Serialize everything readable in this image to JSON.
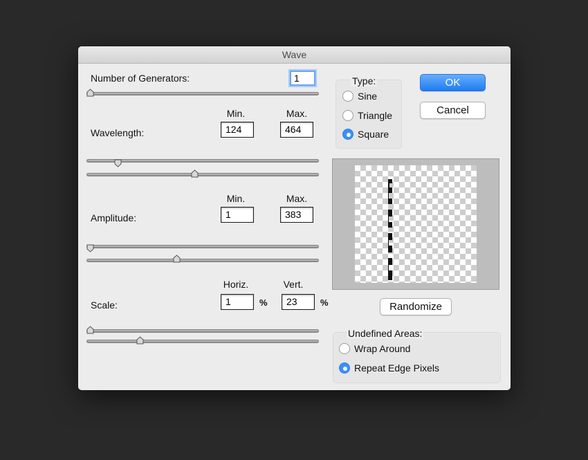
{
  "window": {
    "title": "Wave"
  },
  "generators": {
    "label": "Number of Generators:",
    "value": "1",
    "slider_position": 0.0
  },
  "column_headers": {
    "min": "Min.",
    "max": "Max.",
    "horiz": "Horiz.",
    "vert": "Vert."
  },
  "wavelength": {
    "label": "Wavelength:",
    "min": "124",
    "max": "464",
    "min_slider": 0.13,
    "max_slider": 0.46
  },
  "amplitude": {
    "label": "Amplitude:",
    "min": "1",
    "max": "383",
    "min_slider": 0.0,
    "max_slider": 0.39
  },
  "scale": {
    "label": "Scale:",
    "horiz": "1",
    "vert": "23",
    "unit": "%",
    "horiz_slider": 0.0,
    "vert_slider": 0.22
  },
  "type": {
    "legend": "Type:",
    "options": [
      {
        "label": "Sine",
        "selected": false
      },
      {
        "label": "Triangle",
        "selected": false
      },
      {
        "label": "Square",
        "selected": true
      }
    ]
  },
  "buttons": {
    "ok": "OK",
    "cancel": "Cancel",
    "randomize": "Randomize"
  },
  "undefined_areas": {
    "legend": "Undefined Areas:",
    "options": [
      {
        "label": "Wrap Around",
        "selected": false
      },
      {
        "label": "Repeat Edge Pixels",
        "selected": true
      }
    ]
  },
  "colors": {
    "accent": "#3b8ff5",
    "background": "#292929",
    "dialog": "#ececec"
  }
}
